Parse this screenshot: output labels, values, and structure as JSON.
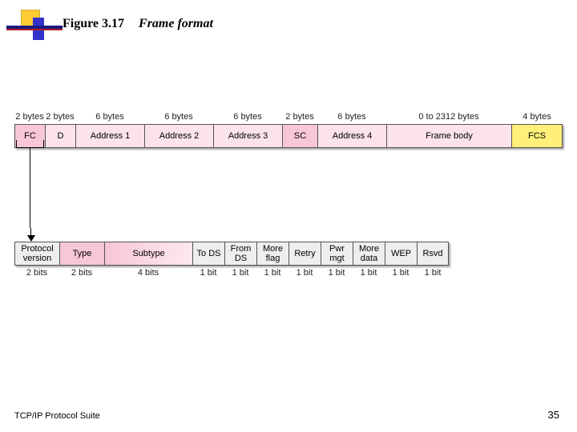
{
  "title": {
    "figure": "Figure 3.17",
    "caption": "Frame format"
  },
  "frame": {
    "sizes": [
      "2 bytes",
      "2 bytes",
      "6 bytes",
      "6 bytes",
      "6 bytes",
      "2 bytes",
      "6 bytes",
      "0 to 2312 bytes",
      "4 bytes"
    ],
    "labels": [
      "FC",
      "D",
      "Address 1",
      "Address 2",
      "Address 3",
      "SC",
      "Address 4",
      "Frame body",
      "FCS"
    ]
  },
  "fc": {
    "labels": [
      "Protocol version",
      "Type",
      "Subtype",
      "To DS",
      "From DS",
      "More flag",
      "Retry",
      "Pwr mgt",
      "More data",
      "WEP",
      "Rsvd"
    ],
    "sizes": [
      "2 bits",
      "2 bits",
      "4 bits",
      "1 bit",
      "1 bit",
      "1 bit",
      "1 bit",
      "1 bit",
      "1 bit",
      "1 bit",
      "1 bit"
    ]
  },
  "footer": {
    "left": "TCP/IP Protocol Suite",
    "right": "35"
  },
  "chart_data": {
    "type": "table",
    "title": "IEEE 802.11 MAC frame format",
    "frame_fields": [
      {
        "name": "FC",
        "size_bytes": 2
      },
      {
        "name": "D",
        "size_bytes": 2
      },
      {
        "name": "Address 1",
        "size_bytes": 6
      },
      {
        "name": "Address 2",
        "size_bytes": 6
      },
      {
        "name": "Address 3",
        "size_bytes": 6
      },
      {
        "name": "SC",
        "size_bytes": 2
      },
      {
        "name": "Address 4",
        "size_bytes": 6
      },
      {
        "name": "Frame body",
        "size_bytes_min": 0,
        "size_bytes_max": 2312
      },
      {
        "name": "FCS",
        "size_bytes": 4
      }
    ],
    "fc_subfields": [
      {
        "name": "Protocol version",
        "size_bits": 2
      },
      {
        "name": "Type",
        "size_bits": 2
      },
      {
        "name": "Subtype",
        "size_bits": 4
      },
      {
        "name": "To DS",
        "size_bits": 1
      },
      {
        "name": "From DS",
        "size_bits": 1
      },
      {
        "name": "More flag",
        "size_bits": 1
      },
      {
        "name": "Retry",
        "size_bits": 1
      },
      {
        "name": "Pwr mgt",
        "size_bits": 1
      },
      {
        "name": "More data",
        "size_bits": 1
      },
      {
        "name": "WEP",
        "size_bits": 1
      },
      {
        "name": "Rsvd",
        "size_bits": 1
      }
    ]
  }
}
